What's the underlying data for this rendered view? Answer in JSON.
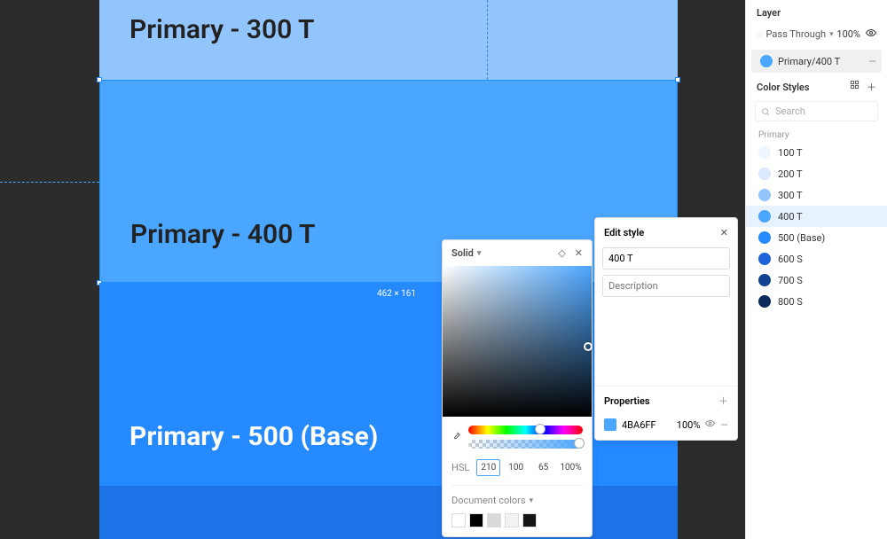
{
  "canvas": {
    "label_300": "Primary - 300 T",
    "label_400": "Primary - 400 T",
    "label_500": "Primary - 500 (Base)",
    "selection_size": "462 × 161"
  },
  "sidebar": {
    "layer_title": "Layer",
    "blend_mode": "Pass Through",
    "opacity": "100%",
    "selected_layer": "Primary/400 T",
    "color_styles_title": "Color Styles",
    "search_placeholder": "Search",
    "group_name": "Primary",
    "styles": [
      {
        "name": "100 T",
        "color": "#eff6ff"
      },
      {
        "name": "200 T",
        "color": "#dbeafe"
      },
      {
        "name": "300 T",
        "color": "#93c5fd"
      },
      {
        "name": "400 T",
        "color": "#4BA6FF"
      },
      {
        "name": "500 (Base)",
        "color": "#2589ff"
      },
      {
        "name": "600 S",
        "color": "#1d63d8"
      },
      {
        "name": "700 S",
        "color": "#11418f"
      },
      {
        "name": "800 S",
        "color": "#0b2a5b"
      }
    ]
  },
  "edit_style": {
    "title": "Edit style",
    "name_value": "400 T",
    "desc_placeholder": "Description",
    "props_title": "Properties",
    "hex": "4BA6FF",
    "opacity": "100%"
  },
  "picker": {
    "mode": "Solid",
    "hsl_label": "HSL",
    "h": "210",
    "s": "100",
    "l": "65",
    "a": "100%",
    "doc_label": "Document colors",
    "doc_colors": [
      "#ffffff",
      "#000000",
      "#d9d9d9",
      "#f2f2f2",
      "#141414"
    ]
  }
}
